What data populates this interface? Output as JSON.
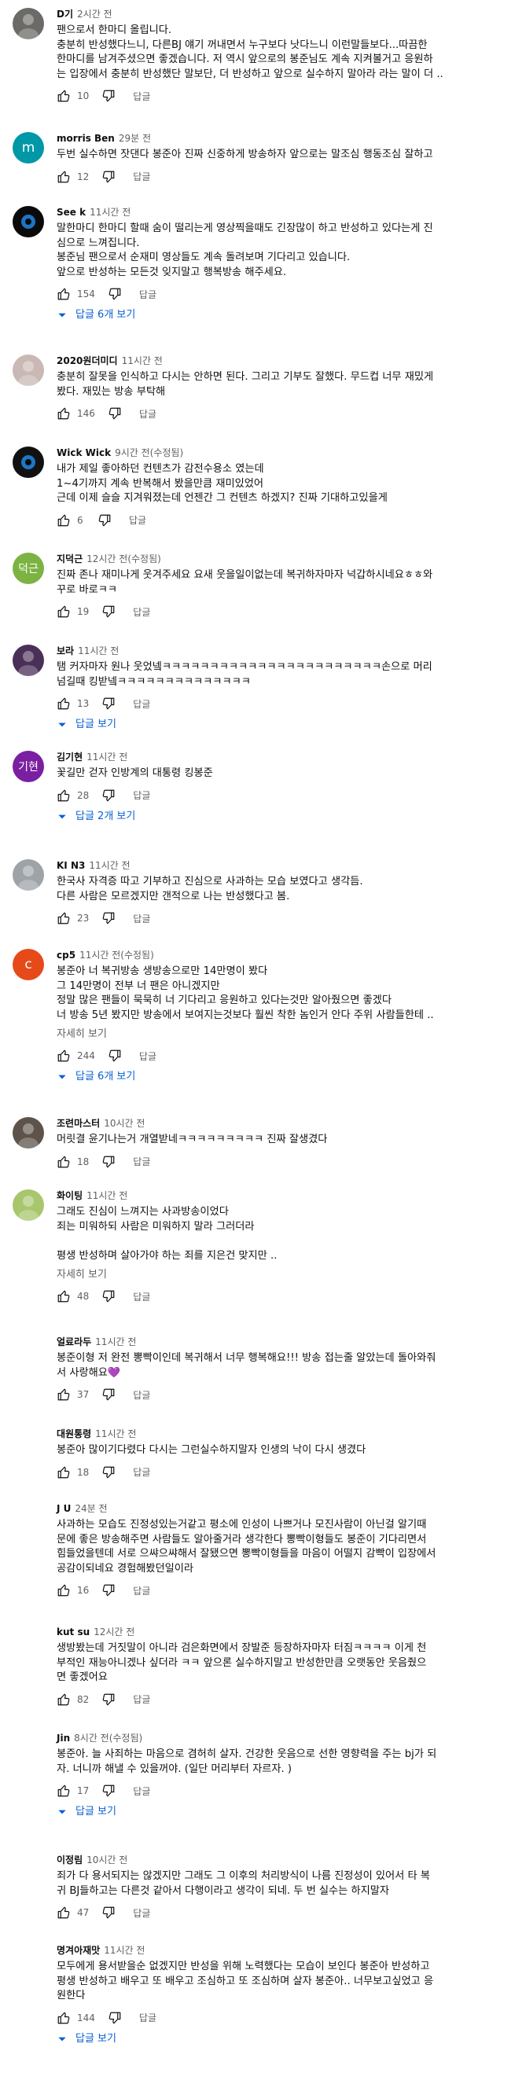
{
  "reply_label": "답글",
  "read_more_label": "자세히 보기",
  "comments": [
    {
      "author": "D기",
      "time": "2시간 전",
      "avatar": {
        "kind": "photo",
        "bg": "#6b6a66"
      },
      "lines": [
        "팬으로서 한마디 올립니다.",
        "충분히 반성했다느니, 다른BJ 얘기 꺼내면서 누구보다 낫다느니 이런말들보다...따끔한",
        "한마디를 남겨주셨으면 좋겠습니다. 저 역시 앞으로의 봉준님도 계속 지켜볼거고 응원하",
        "는 입장에서 충분히 반성했단 말보단, 더 반성하고 앞으로 실수하지 말아라 라는 말이 더 .."
      ],
      "likes": "10"
    },
    {
      "author": "morris Ben",
      "time": "29분 전",
      "avatar": {
        "kind": "letter",
        "letter": "m",
        "bg": "#0097a7"
      },
      "lines": [
        "두번 실수하면 잣댄다 봉준아 진짜 신중하게 방송하자 앞으로는 말조심 행동조심 잘하고"
      ],
      "likes": "12"
    },
    {
      "author": "See k",
      "time": "11시간 전",
      "avatar": {
        "kind": "dark",
        "bg": "#0a0a0a"
      },
      "lines": [
        "말한마디 한마디 할때 숨이 떨리는게 영상찍을때도 긴장많이 하고 반성하고 있다는게 진",
        "심으로 느껴집니다.",
        "봉준님 팬으로서 순재미 영상들도 계속 돌려보며 기다리고 있습니다.",
        "앞으로 반성하는 모든것 잊지말고 행복방송 해주세요."
      ],
      "likes": "154",
      "replies": "답글 6개 보기"
    },
    {
      "author": "2020원더미디",
      "time": "11시간 전",
      "avatar": {
        "kind": "photo",
        "bg": "#c9b8b3"
      },
      "lines": [
        "충분히 잘못을 인식하고 다시는 안하면 된다. 그리고 기부도 잘했다. 무드컵 너무 재밌게",
        "봤다. 재밌는 방송 부탁해"
      ],
      "likes": "146"
    },
    {
      "author": "Wick Wick",
      "time": "9시간 전(수정됨)",
      "avatar": {
        "kind": "dark",
        "bg": "#111111"
      },
      "lines": [
        "내가 제일 좋아하던 컨텐츠가 감전수용소 였는데",
        "1~4기까지 계속 반복해서 봤을만큼 재미있었어",
        "근데 이제 슬슬 지겨워졌는데 언젠간 그 컨텐츠 하겠지? 진짜 기대하고있을게"
      ],
      "likes": "6"
    },
    {
      "author": "지덕근",
      "time": "12시간 전(수정됨)",
      "avatar": {
        "kind": "letter",
        "letter": "덕근",
        "bg": "#7cb342"
      },
      "lines": [
        "진짜 존나 재미나게 웃겨주세요 요새 웃을일이없는데 복귀하자마자 넉갑하시네요ㅎㅎ와",
        "꾸로 바로ㅋㅋ"
      ],
      "likes": "19"
    },
    {
      "author": "보라",
      "time": "11시간 전",
      "avatar": {
        "kind": "photo",
        "bg": "#4a2f57"
      },
      "lines": [
        "탬 커자마자 원나 웃었넼ㅋㅋㅋㅋㅋㅋㅋㅋㅋㅋㅋㅋㅋㅋㅋㅋㅋㅋㅋㅋㅋㅋㅋ손으로 머리",
        "넘길때 킹받넼ㅋㅋㅋㅋㅋㅋㅋㅋㅋㅋㅋㅋㅋㅋ"
      ],
      "likes": "13",
      "replies": "답글 보기"
    },
    {
      "author": "김기현",
      "time": "11시간 전",
      "avatar": {
        "kind": "letter",
        "letter": "기현",
        "bg": "#7b1fa2"
      },
      "lines": [
        "꽃길만 걷자 인방계의 대통령 킹봉준"
      ],
      "likes": "28",
      "replies": "답글 2개 보기"
    },
    {
      "author": "KI N3",
      "time": "11시간 전",
      "avatar": {
        "kind": "photo",
        "bg": "#9ea3a8"
      },
      "lines": [
        "한국사 자격증 따고 기부하고 진심으로 사과하는 모습 보였다고 생각듬.",
        "다른 사람은 모르겠지만 갠적으로 나는 반성했다고 봄."
      ],
      "likes": "23"
    },
    {
      "author": "cp5",
      "time": "11시간 전(수정됨)",
      "avatar": {
        "kind": "letter",
        "letter": "c",
        "bg": "#e64a19"
      },
      "lines": [
        "봉준아 너 복귀방송 생방송으로만 14만명이 봤다",
        "그 14만명이 전부 너 팬은 아니겠지만",
        "정말 많은 팬들이 묵묵히 너 기다리고 응원하고 있다는것만 알아줬으면 좋겠다",
        "너 방송 5년 봤지만 방송에서 보여지는것보다 훨씬 착한 놈인거 안다 주위 사람들한테 .."
      ],
      "readmore": true,
      "likes": "244",
      "replies": "답글 6개 보기"
    },
    {
      "author": "조련마스터",
      "time": "10시간 전",
      "avatar": {
        "kind": "photo",
        "bg": "#5d534a"
      },
      "lines": [
        "머릿결 윤기나는거 개열받네ㅋㅋㅋㅋㅋㅋㅋㅋㅋ   진짜 잘생겼다"
      ],
      "likes": "18"
    },
    {
      "author": "화이팅",
      "time": "11시간 전",
      "avatar": {
        "kind": "photo",
        "bg": "#a8c66c"
      },
      "lines": [
        "그래도 진심이 느껴지는 사과방송이었다",
        "죄는 미워하되 사람은 미워하지 말라 그러더라",
        "",
        "평생 반성하며 살아가야 하는 죄를 지은건 맞지만 .."
      ],
      "readmore": true,
      "likes": "48"
    },
    {
      "author": "얼료라두",
      "time": "11시간 전",
      "avatar": {
        "kind": "none"
      },
      "lines": [
        "봉준이형 저 완전 뽕빡이인데 복귀해서 너무 행복해요!!! 방송 접는줄 알았는데 돌아와줘",
        "서 사랑해요💜"
      ],
      "likes": "37"
    },
    {
      "author": "대원통령",
      "time": "11시간 전",
      "avatar": {
        "kind": "none"
      },
      "lines": [
        "봉준아 많이기다렸다 다시는 그런실수하지말자 인생의 낙이 다시 생겼다"
      ],
      "likes": "18"
    },
    {
      "author": "J U",
      "time": "24분 전",
      "avatar": {
        "kind": "none"
      },
      "lines": [
        "사과하는 모습도 진정성있는거같고 평소에 인성이 나쁘거나 모진사람이 아닌걸 알기때",
        "문에 좋은 방송해주면 사람들도 알아줄거라 생각한다 뽕빡이형들도 봉준이 기다리면서",
        "힘들었을텐데 서로 으쌰으쌰해서 잘됐으면 뽕빡이형들을 마음이 어떨지 감빡이 입장에서",
        "공감이되네요 경험해봤던일이라"
      ],
      "likes": "16"
    },
    {
      "author": "kut su",
      "time": "12시간 전",
      "avatar": {
        "kind": "none"
      },
      "lines": [
        "생방봤는데 거짓말이 아니라 검은화면에서 장발준 등장하자마자 터짐ㅋㅋㅋㅋ 이게 천",
        "부적인 재능아니겠나 싶더라 ㅋㅋ 앞으론 실수하지말고 반성한만큼 오랫동안 웃음줬으",
        "면 좋겠어요"
      ],
      "likes": "82"
    },
    {
      "author": "Jin",
      "time": "8시간 전(수정됨)",
      "avatar": {
        "kind": "none"
      },
      "lines": [
        "봉준아. 늘 사죄하는 마음으로 겸허히 살자. 건강한 웃음으로 선한 영향력을 주는 bj가 되",
        "자. 너니까 해낼 수 있을꺼야. (일단 머리부터 자르자. )"
      ],
      "likes": "17",
      "replies": "답글 보기"
    },
    {
      "author": "이정림",
      "time": "10시간 전",
      "avatar": {
        "kind": "none"
      },
      "lines": [
        "죄가 다 용서되지는 않겠지만 그래도 그 이후의 처리방식이 나름 진정성이 있어서 타 복",
        "귀 BJ들하고는 다른것 같아서 다행이라고 생각이 되네. 두 번 실수는 하지말자"
      ],
      "likes": "47"
    },
    {
      "author": "명겨아재맛",
      "time": "11시간 전",
      "avatar": {
        "kind": "none"
      },
      "lines": [
        "모두에게 용서받을순 없겠지만 반성을 위해 노력했다는 모습이 보인다 봉준아 반성하고",
        "평생 반성하고 배우고 또 배우고 조심하고 또 조심하며 살자 봉준아.. 너무보고싶었고 응",
        "원한다"
      ],
      "likes": "144",
      "replies": "답글 보기"
    }
  ]
}
